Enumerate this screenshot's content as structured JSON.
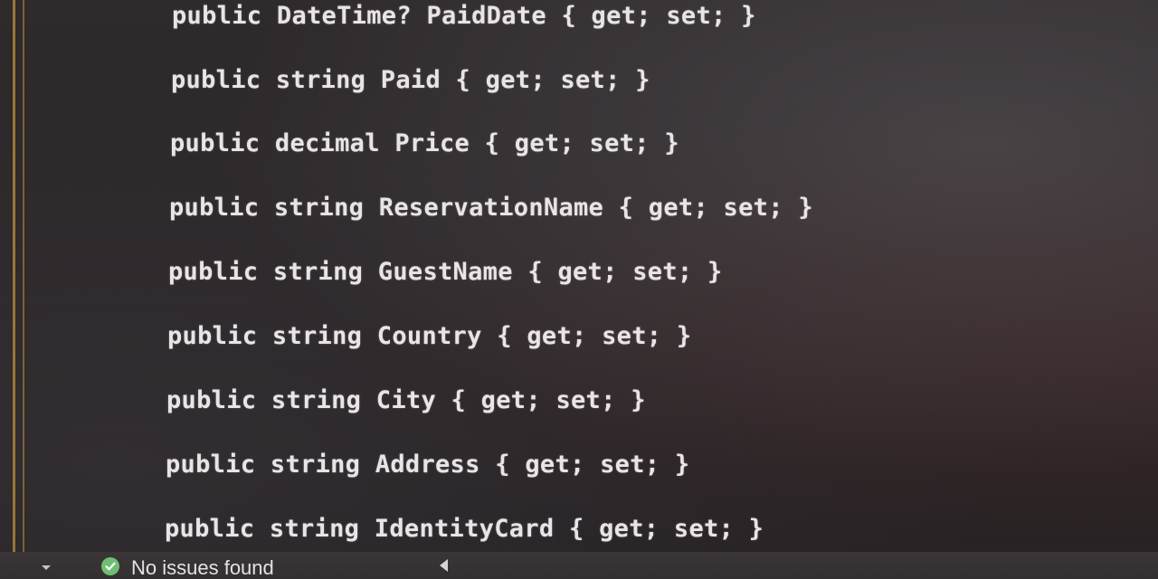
{
  "editor": {
    "code_lines": [
      "public DateTime? PaidDate { get; set; }",
      "public string Paid { get; set; }",
      "public decimal Price { get; set; }",
      "public string ReservationName { get; set; }",
      "public string GuestName { get; set; }",
      "public string Country { get; set; }",
      "public string City { get; set; }",
      "public string Address { get; set; }",
      "public string IdentityCard { get; set; }"
    ]
  },
  "status_bar": {
    "issues_text": "No issues found",
    "status_icon": "check-circle-icon",
    "status_color": "#6fbf73"
  }
}
